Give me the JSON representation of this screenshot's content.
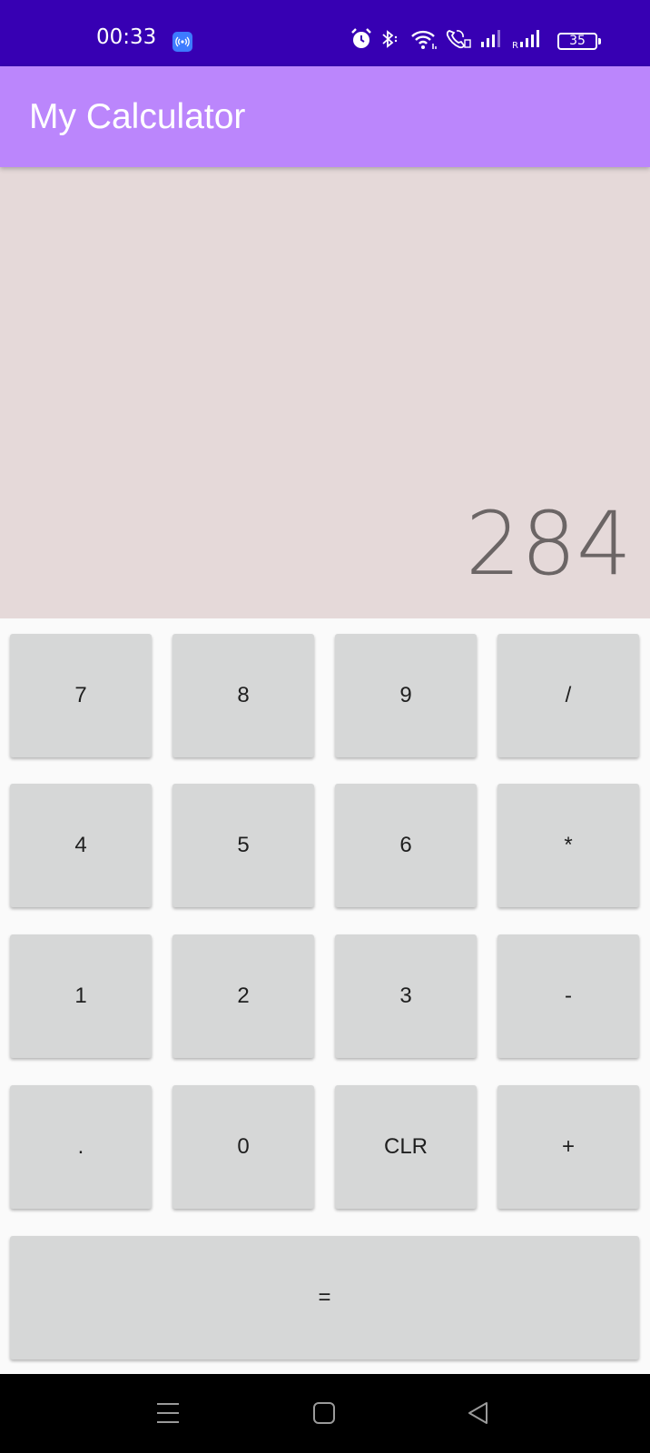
{
  "status_bar": {
    "time": "00:33",
    "battery": "35",
    "roaming_indicator": "R",
    "icons": [
      "hotspot-icon",
      "alarm-icon",
      "bluetooth-icon",
      "wifi-icon",
      "wifi-call-icon",
      "signal-icon",
      "signal-roaming-icon",
      "battery-icon"
    ]
  },
  "app_bar": {
    "title": "My Calculator",
    "color": "#bb86fc"
  },
  "display": {
    "value": "284"
  },
  "keypad": {
    "rows": [
      [
        "7",
        "8",
        "9",
        "/"
      ],
      [
        "4",
        "5",
        "6",
        "*"
      ],
      [
        "1",
        "2",
        "3",
        "-"
      ],
      [
        ".",
        "0",
        "CLR",
        "+"
      ]
    ],
    "equals": "="
  },
  "nav_bar": {
    "icons": [
      "menu-icon",
      "home-icon",
      "back-icon"
    ]
  },
  "colors": {
    "status_bar": "#3700b3",
    "app_bar": "#bb86fc",
    "display_bg": "#e5d9d9",
    "key_bg": "#d6d7d7",
    "display_text": "#6b6565"
  }
}
